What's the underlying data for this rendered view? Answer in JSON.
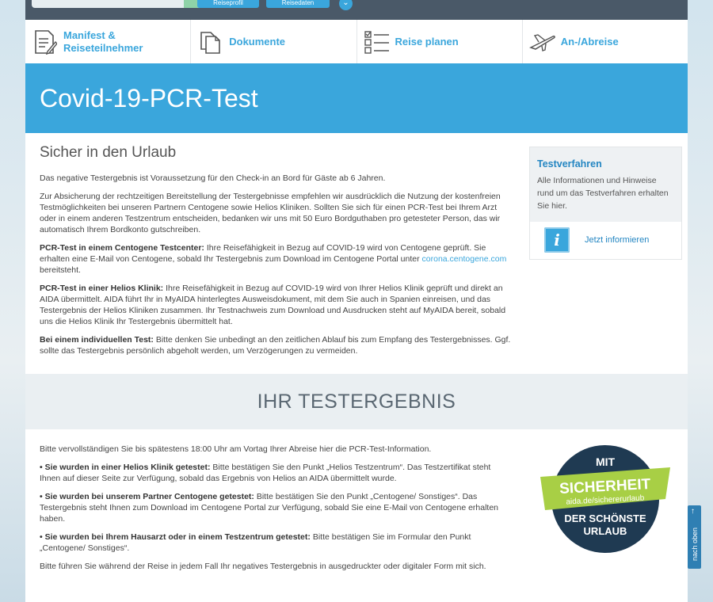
{
  "topbar": {
    "button1_label": "Reiseprofil",
    "button2_label": "Reisedaten",
    "chevron": "⌄"
  },
  "nav": {
    "items": [
      {
        "label": "Manifest & Reiseteilnehmer",
        "icon": "document-pen-icon"
      },
      {
        "label": "Dokumente",
        "icon": "documents-icon"
      },
      {
        "label": "Reise planen",
        "icon": "checklist-icon"
      },
      {
        "label": "An-/Abreise",
        "icon": "airplane-icon"
      }
    ]
  },
  "hero": {
    "title": "Covid-19-PCR-Test"
  },
  "main": {
    "heading": "Sicher in den Urlaub",
    "p1": "Das negative Testergebnis ist Voraussetzung für den Check-in an Bord für Gäste ab 6 Jahren.",
    "p2": "Zur Absicherung der rechtzeitigen Bereitstellung der Testergebnisse empfehlen wir ausdrücklich die Nutzung der kostenfreien Testmöglichkeiten bei unseren Partnern Centogene sowie Helios Kliniken. Sollten Sie sich für einen PCR-Test bei Ihrem Arzt oder in einem anderen Testzentrum entscheiden, bedanken wir uns mit 50 Euro Bordguthaben pro getesteter Person, das wir automatisch Ihrem Bordkonto gutschreiben.",
    "p3_bold": "PCR-Test in einem Centogene Testcenter:",
    "p3_text": " Ihre Reisefähigkeit in Bezug auf COVID-19 wird von Centogene geprüft. Sie erhalten eine E-Mail von Centogene, sobald Ihr Testergebnis zum Download im Centogene Portal unter ",
    "p3_link": "corona.centogene.com",
    "p3_after": " bereitsteht.",
    "p4_bold": "PCR-Test in einer Helios Klinik:",
    "p4_text": " Ihre Reisefähigkeit in Bezug auf COVID-19 wird von Ihrer Helios Klinik geprüft und direkt an AIDA übermittelt. AIDA führt Ihr in MyAIDA hinterlegtes Ausweisdokument, mit dem Sie auch in Spanien einreisen, und das Testergebnis der Helios Kliniken zusammen. Ihr Testnachweis zum Download und Ausdrucken steht auf MyAIDA bereit, sobald uns die Helios Klinik Ihr Testergebnis übermittelt hat.",
    "p5_bold": "Bei einem individuellen Test:",
    "p5_text": " Bitte denken Sie unbedingt an den zeitlichen Ablauf bis zum Empfang des Testergebnisses. Ggf. sollte das Testergebnis persönlich abgeholt werden, um Verzögerungen zu vermeiden."
  },
  "sidebox": {
    "title": "Testverfahren",
    "text": "Alle Informationen und Hinweise rund um das Testverfahren erhalten Sie hier.",
    "info_glyph": "i",
    "link": "Jetzt informieren"
  },
  "result": {
    "heading": "IHR TESTERGEBNIS",
    "intro": "Bitte vervollständigen Sie bis spätestens 18:00 Uhr am Vortag Ihrer Abreise hier die PCR-Test-Information.",
    "b1_bold": "• Sie wurden in einer Helios Klinik getestet:",
    "b1_text": " Bitte bestätigen Sie den Punkt „Helios Testzentrum“. Das Testzertifikat steht Ihnen auf dieser Seite zur Verfügung, sobald das Ergebnis von Helios an AIDA übermittelt wurde.",
    "b2_bold": "• Sie wurden bei unserem Partner Centogene getestet:",
    "b2_text": " Bitte bestätigen Sie den Punkt „Centogene/ Sonstiges“. Das Testergebnis steht Ihnen zum Download im Centogene Portal zur Verfügung, sobald Sie eine E-Mail von Centogene erhalten haben.",
    "b3_bold": "• Sie wurden bei Ihrem Hausarzt oder in einem Testzentrum getestet:",
    "b3_text": " Bitte bestätigen Sie im Formular den Punkt „Centogene/ Sonstiges“.",
    "outro": "Bitte führen Sie während der Reise in jedem Fall Ihr negatives Testergebnis in ausgedruckter oder digitaler Form mit sich."
  },
  "badge": {
    "line1": "MIT",
    "line2": "SICHERHEIT",
    "url": "aida.de/sichererurlaub",
    "line3": "DER SCHÖNSTE",
    "line4": "URLAUB",
    "colors": {
      "navy": "#1f3a52",
      "green": "#a8cf45"
    }
  },
  "scroll_top": {
    "label": "nach oben",
    "arrow": "↑"
  },
  "colors": {
    "accent": "#3aa6dc",
    "topbar": "#4a5968"
  }
}
